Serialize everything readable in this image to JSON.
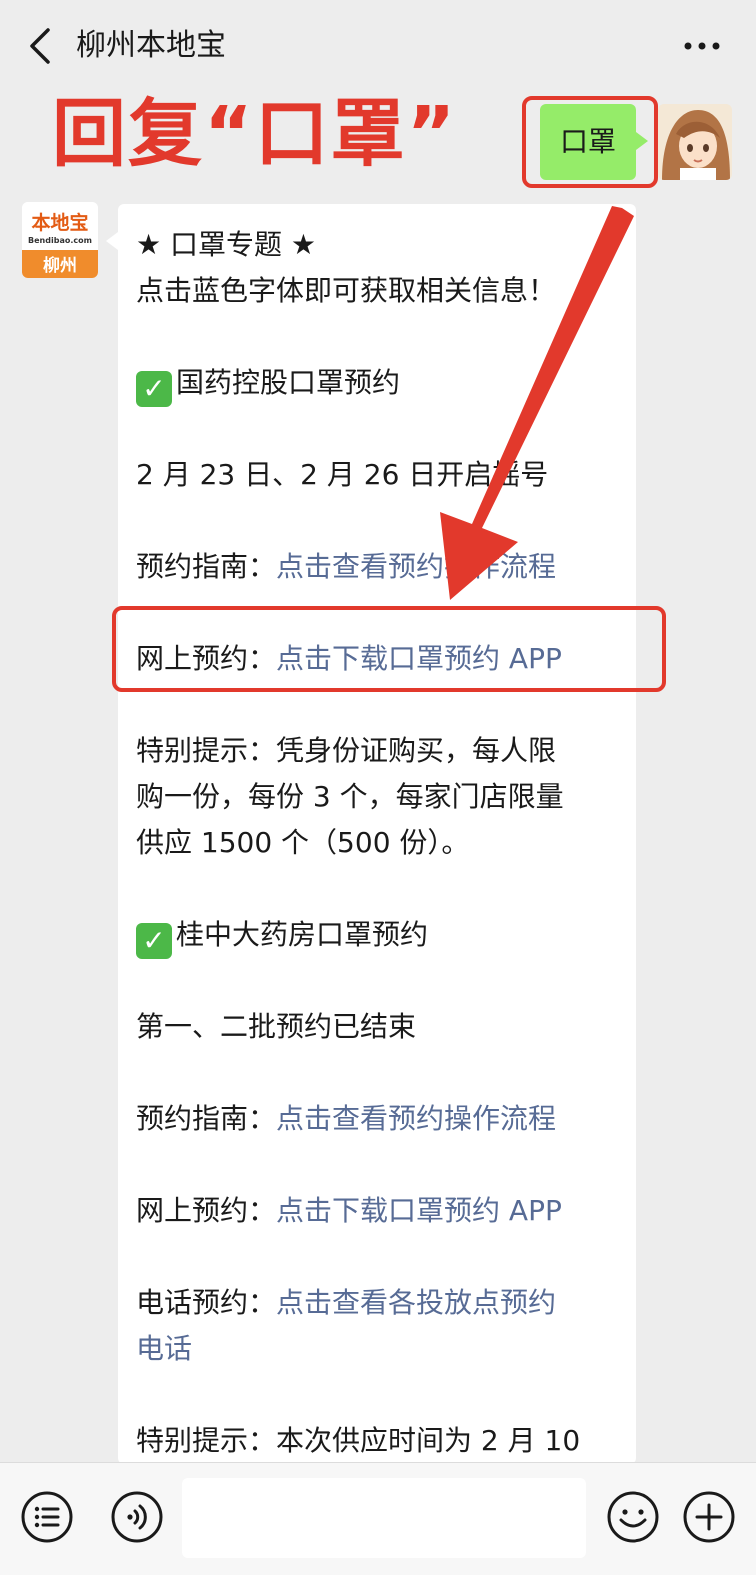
{
  "header": {
    "title": "柳州本地宝",
    "back_icon": "chevron-left-icon",
    "more_icon": "more-dots-icon"
  },
  "annotation": {
    "text": "回复“口罩”",
    "color": "#e2392c"
  },
  "outgoing": {
    "text": "口罩",
    "bubble_color": "#95ec69"
  },
  "incoming": {
    "avatar": {
      "brand": "本地宝",
      "domain": "Bendibao.com",
      "city": "柳州"
    },
    "lines": {
      "l1": "★ 口罩专题 ★",
      "l2": "点击蓝色字体即可获取相关信息！",
      "l3": "国药控股口罩预约",
      "l4": "2 月 23 日、2 月 26 日开启摇号",
      "l5_label": "预约指南：",
      "l5_link": "点击查看预约操作流程",
      "l6_label": "网上预约：",
      "l6_link": "点击下载口罩预约 APP",
      "l7a": "特别提示：凭身份证购买，每人限",
      "l7b": "购一份，每份 3 个，每家门店限量",
      "l7c": "供应 1500 个（500 份）。",
      "l8": "桂中大药房口罩预约",
      "l9": "第一、二批预约已结束",
      "l10_label": "预约指南：",
      "l10_link": "点击查看预约操作流程",
      "l11_label": "网上预约：",
      "l11_link": "点击下载口罩预约 APP",
      "l12_label": "电话预约：",
      "l12_link_a": "点击查看各投放点预约",
      "l12_link_b": "电话",
      "l13": "特别提示：本次供应时间为 2 月 10"
    },
    "check_mark": "✓",
    "link_color": "#576b95"
  },
  "bottom_bar": {
    "menu_icon": "list-menu-icon",
    "voice_icon": "voice-icon",
    "emoji_icon": "smiley-icon",
    "plus_icon": "plus-icon"
  }
}
